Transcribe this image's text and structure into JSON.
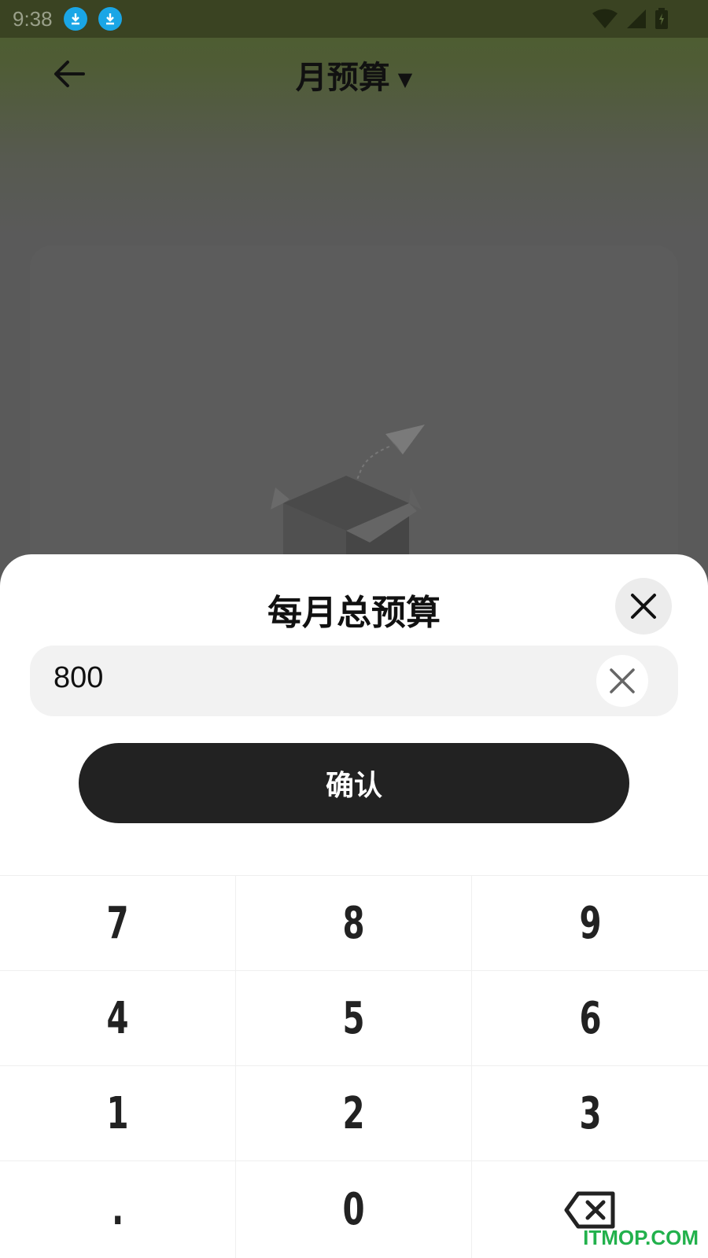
{
  "status_bar": {
    "time": "9:38"
  },
  "header": {
    "title": "月预算",
    "title_caret": "▼"
  },
  "sheet": {
    "title": "每月总预算",
    "amount_value": "800",
    "confirm_label": "确认"
  },
  "keypad": {
    "keys": [
      "7",
      "8",
      "9",
      "4",
      "5",
      "6",
      "1",
      "2",
      "3",
      ".",
      "0"
    ]
  },
  "watermark": "ITMOP.COM",
  "icons": {
    "back": "arrow-left-icon",
    "close": "close-icon",
    "clear": "clear-icon",
    "backspace": "backspace-icon"
  }
}
